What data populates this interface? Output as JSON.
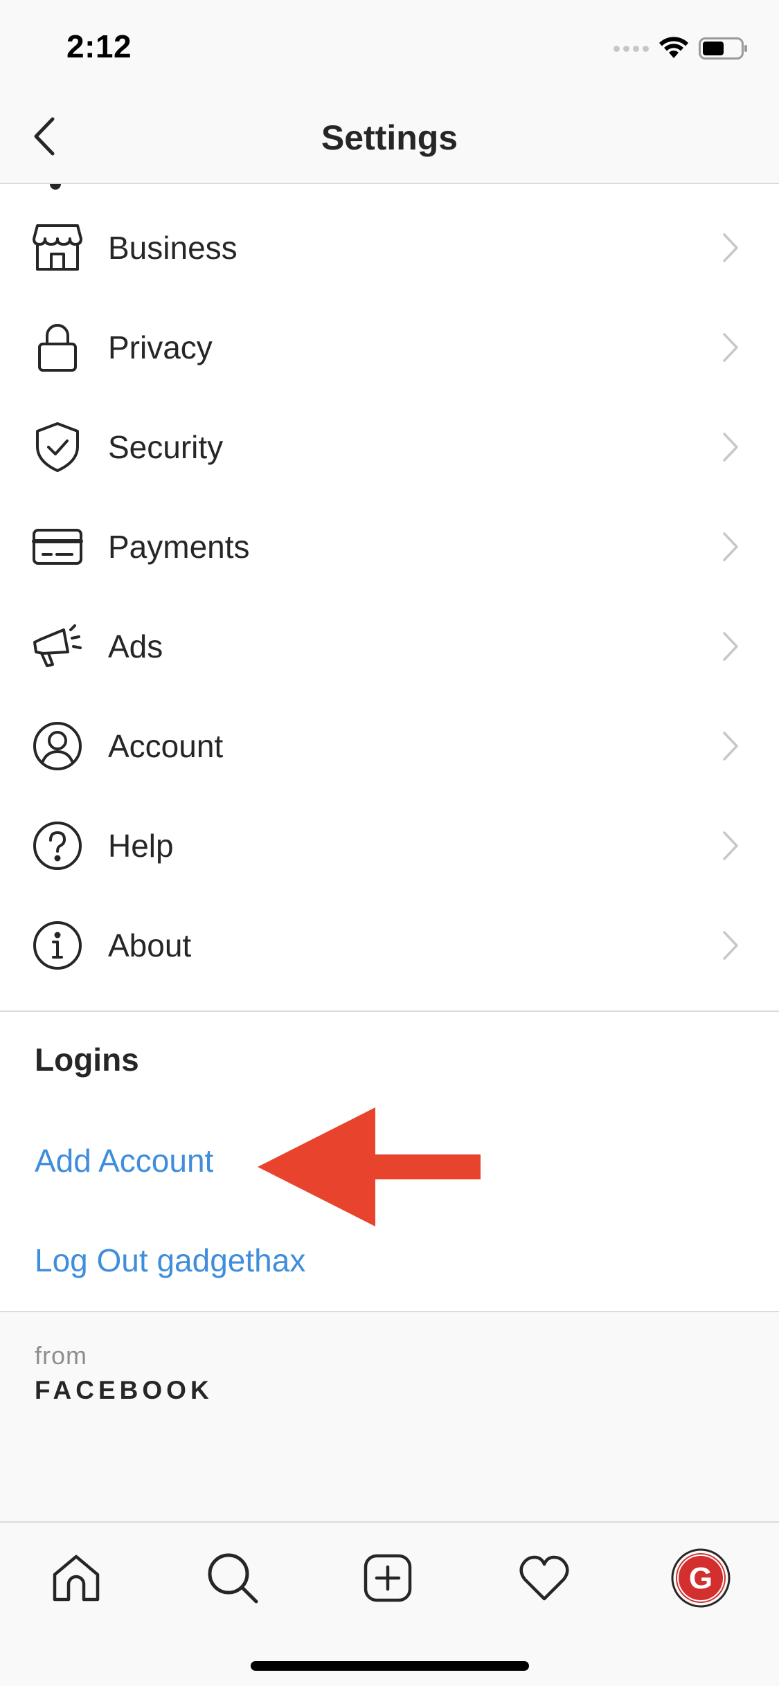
{
  "status_bar": {
    "time": "2:12"
  },
  "nav": {
    "title": "Settings"
  },
  "settings": {
    "items": [
      {
        "label": "Business",
        "icon": "shop-icon"
      },
      {
        "label": "Privacy",
        "icon": "lock-icon"
      },
      {
        "label": "Security",
        "icon": "shield-check-icon"
      },
      {
        "label": "Payments",
        "icon": "credit-card-icon"
      },
      {
        "label": "Ads",
        "icon": "megaphone-icon"
      },
      {
        "label": "Account",
        "icon": "user-circle-icon"
      },
      {
        "label": "Help",
        "icon": "question-circle-icon"
      },
      {
        "label": "About",
        "icon": "info-circle-icon"
      }
    ]
  },
  "logins": {
    "title": "Logins",
    "add_account": "Add Account",
    "log_out": "Log Out gadgethax"
  },
  "footer": {
    "from": "from",
    "brand": "FACEBOOK"
  },
  "tab_bar": {
    "tabs": [
      "home-icon",
      "search-icon",
      "new-post-icon",
      "heart-icon",
      "profile-avatar"
    ],
    "avatar_letter": "G"
  },
  "colors": {
    "link": "#3f8ddb",
    "arrow": "#e8432c",
    "avatar": "#d32f2f"
  }
}
